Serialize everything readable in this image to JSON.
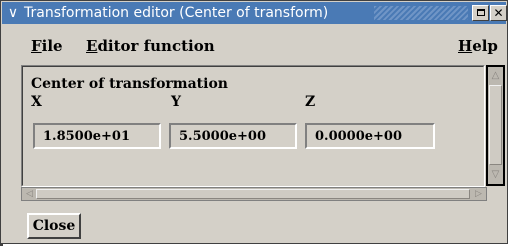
{
  "window": {
    "title": "Transformation editor (Center of transform)",
    "menu_icon": "∨",
    "minimize_icon": "minimize-icon",
    "close_icon": "✕"
  },
  "menubar": {
    "file": {
      "mnemonic": "F",
      "rest": "ile"
    },
    "editor_function": {
      "mnemonic": "E",
      "rest": "ditor function"
    },
    "help": {
      "mnemonic": "H",
      "rest": "elp"
    }
  },
  "center": {
    "section_title": "Center of transformation",
    "x_label": "X",
    "y_label": "Y",
    "z_label": "Z",
    "x_value": "1.8500e+01",
    "y_value": "5.5000e+00",
    "z_value": "0.0000e+00"
  },
  "scrollbars": {
    "up_arrow": "△",
    "down_arrow": "▽",
    "left_arrow": "◁",
    "right_arrow": "▷"
  },
  "footer": {
    "close_label": "Close"
  },
  "colors": {
    "titlebar_bg": "#4a7ab5",
    "window_bg": "#d4d0c8",
    "scrollbar_trough": "#bcb8b0"
  }
}
